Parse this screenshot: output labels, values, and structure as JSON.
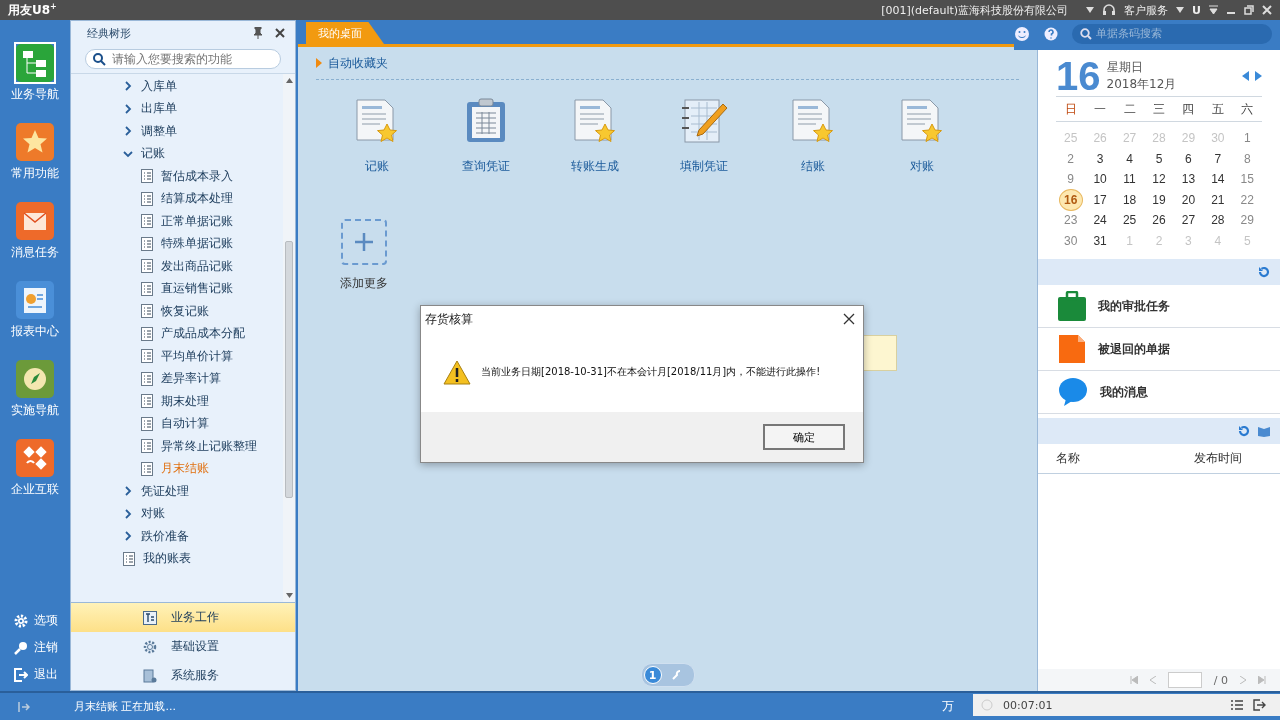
{
  "title_bar": {
    "logo": "用友U8",
    "logo_sup": "+",
    "company": "[001](default)蓝海科技股份有限公司",
    "service": "客户服务",
    "u_label": "U"
  },
  "nav": {
    "items": [
      {
        "label": "业务导航",
        "kind": "tree",
        "color": "#2aa53a",
        "selected": true
      },
      {
        "label": "常用功能",
        "kind": "star",
        "color": "#ee7a2a",
        "selected": false
      },
      {
        "label": "消息任务",
        "kind": "mail",
        "color": "#ee6a2a",
        "selected": false
      },
      {
        "label": "报表中心",
        "kind": "report",
        "color": "#4a8fd8",
        "selected": false
      },
      {
        "label": "实施导航",
        "kind": "compass",
        "color": "#6c9a3a",
        "selected": false
      },
      {
        "label": "企业互联",
        "kind": "link",
        "color": "#ee6a2a",
        "selected": false
      }
    ],
    "bottom": [
      {
        "label": "选项",
        "kind": "gear"
      },
      {
        "label": "注销",
        "kind": "key"
      },
      {
        "label": "退出",
        "kind": "exit"
      }
    ]
  },
  "tree_panel": {
    "title": "经典树形",
    "search_placeholder": "请输入您要搜索的功能",
    "items": [
      {
        "label": "入库单",
        "kind": "folder",
        "expanded": false,
        "selected": false
      },
      {
        "label": "出库单",
        "kind": "folder",
        "expanded": false,
        "selected": false
      },
      {
        "label": "调整单",
        "kind": "folder",
        "expanded": false,
        "selected": false
      },
      {
        "label": "记账",
        "kind": "folder",
        "expanded": true,
        "selected": false,
        "children": [
          {
            "label": "暂估成本录入",
            "kind": "leaf",
            "selected": false
          },
          {
            "label": "结算成本处理",
            "kind": "leaf",
            "selected": false
          },
          {
            "label": "正常单据记账",
            "kind": "leaf",
            "selected": false
          },
          {
            "label": "特殊单据记账",
            "kind": "leaf",
            "selected": false
          },
          {
            "label": "发出商品记账",
            "kind": "leaf",
            "selected": false
          },
          {
            "label": "直运销售记账",
            "kind": "leaf",
            "selected": false
          },
          {
            "label": "恢复记账",
            "kind": "leaf",
            "selected": false
          },
          {
            "label": "产成品成本分配",
            "kind": "leaf",
            "selected": false
          },
          {
            "label": "平均单价计算",
            "kind": "leaf",
            "selected": false
          },
          {
            "label": "差异率计算",
            "kind": "leaf",
            "selected": false
          },
          {
            "label": "期末处理",
            "kind": "leaf",
            "selected": false
          },
          {
            "label": "自动计算",
            "kind": "leaf",
            "selected": false
          },
          {
            "label": "异常终止记账整理",
            "kind": "leaf",
            "selected": false
          },
          {
            "label": "月末结账",
            "kind": "leaf",
            "selected": true
          }
        ]
      },
      {
        "label": "凭证处理",
        "kind": "folder",
        "expanded": false,
        "selected": false
      },
      {
        "label": "对账",
        "kind": "folder",
        "expanded": false,
        "selected": false
      },
      {
        "label": "跌价准备",
        "kind": "folder",
        "expanded": false,
        "selected": false
      },
      {
        "label": "我的账表",
        "kind": "leaf",
        "selected": false
      }
    ],
    "sections": [
      {
        "label": "业务工作",
        "kind": "work",
        "selected": true
      },
      {
        "label": "基础设置",
        "kind": "gear",
        "selected": false
      },
      {
        "label": "系统服务",
        "kind": "server",
        "selected": false
      }
    ]
  },
  "tabs": [
    {
      "label": "我的桌面",
      "selected": true
    }
  ],
  "favorites": {
    "title": "自动收藏夹",
    "items": [
      {
        "label": "记账",
        "kind": "doc"
      },
      {
        "label": "查询凭证",
        "kind": "clipboard"
      },
      {
        "label": "转账生成",
        "kind": "doc"
      },
      {
        "label": "填制凭证",
        "kind": "notebook"
      },
      {
        "label": "结账",
        "kind": "doc"
      },
      {
        "label": "对账",
        "kind": "doc"
      }
    ],
    "add_label": "添加更多"
  },
  "desk_pager": {
    "page": "1"
  },
  "dialog": {
    "title": "存货核算",
    "message": "当前业务日期[2018-10-31]不在本会计月[2018/11月]内，不能进行此操作!",
    "button": "确定"
  },
  "right": {
    "search_placeholder": "单据条码搜索",
    "calendar": {
      "day": "16",
      "weekday": "星期日",
      "month": "2018年12月",
      "weekdays": [
        "日",
        "一",
        "二",
        "三",
        "四",
        "五",
        "六"
      ],
      "days": [
        {
          "d": "25",
          "in_month": false,
          "selected": false
        },
        {
          "d": "26",
          "in_month": false,
          "selected": false
        },
        {
          "d": "27",
          "in_month": false,
          "selected": false
        },
        {
          "d": "28",
          "in_month": false,
          "selected": false
        },
        {
          "d": "29",
          "in_month": false,
          "selected": false
        },
        {
          "d": "30",
          "in_month": false,
          "selected": false
        },
        {
          "d": "1",
          "in_month": true,
          "selected": false
        },
        {
          "d": "2",
          "in_month": true,
          "selected": false
        },
        {
          "d": "3",
          "in_month": true,
          "selected": false
        },
        {
          "d": "4",
          "in_month": true,
          "selected": false
        },
        {
          "d": "5",
          "in_month": true,
          "selected": false
        },
        {
          "d": "6",
          "in_month": true,
          "selected": false
        },
        {
          "d": "7",
          "in_month": true,
          "selected": false
        },
        {
          "d": "8",
          "in_month": true,
          "selected": false
        },
        {
          "d": "9",
          "in_month": true,
          "selected": false
        },
        {
          "d": "10",
          "in_month": true,
          "selected": false
        },
        {
          "d": "11",
          "in_month": true,
          "selected": false
        },
        {
          "d": "12",
          "in_month": true,
          "selected": false
        },
        {
          "d": "13",
          "in_month": true,
          "selected": false
        },
        {
          "d": "14",
          "in_month": true,
          "selected": false
        },
        {
          "d": "15",
          "in_month": true,
          "selected": false
        },
        {
          "d": "16",
          "in_month": true,
          "selected": true
        },
        {
          "d": "17",
          "in_month": true,
          "selected": false
        },
        {
          "d": "18",
          "in_month": true,
          "selected": false
        },
        {
          "d": "19",
          "in_month": true,
          "selected": false
        },
        {
          "d": "20",
          "in_month": true,
          "selected": false
        },
        {
          "d": "21",
          "in_month": true,
          "selected": false
        },
        {
          "d": "22",
          "in_month": true,
          "selected": false
        },
        {
          "d": "23",
          "in_month": true,
          "selected": false
        },
        {
          "d": "24",
          "in_month": true,
          "selected": false
        },
        {
          "d": "25",
          "in_month": true,
          "selected": false
        },
        {
          "d": "26",
          "in_month": true,
          "selected": false
        },
        {
          "d": "27",
          "in_month": true,
          "selected": false
        },
        {
          "d": "28",
          "in_month": true,
          "selected": false
        },
        {
          "d": "29",
          "in_month": true,
          "selected": false
        },
        {
          "d": "30",
          "in_month": true,
          "selected": false
        },
        {
          "d": "31",
          "in_month": true,
          "selected": false
        },
        {
          "d": "1",
          "in_month": false,
          "selected": false
        },
        {
          "d": "2",
          "in_month": false,
          "selected": false
        },
        {
          "d": "3",
          "in_month": false,
          "selected": false
        },
        {
          "d": "4",
          "in_month": false,
          "selected": false
        },
        {
          "d": "5",
          "in_month": false,
          "selected": false
        }
      ]
    },
    "tasks": [
      {
        "label": "我的审批任务",
        "kind": "briefcase"
      },
      {
        "label": "被退回的单据",
        "kind": "document"
      },
      {
        "label": "我的消息",
        "kind": "bubble"
      }
    ],
    "columns": [
      "名称",
      "发布时间"
    ],
    "pager": {
      "total": "/ 0"
    }
  },
  "status_bar": {
    "text": "月末结账 正在加载...",
    "right": "万"
  },
  "timer": {
    "time": "00:07:01"
  }
}
